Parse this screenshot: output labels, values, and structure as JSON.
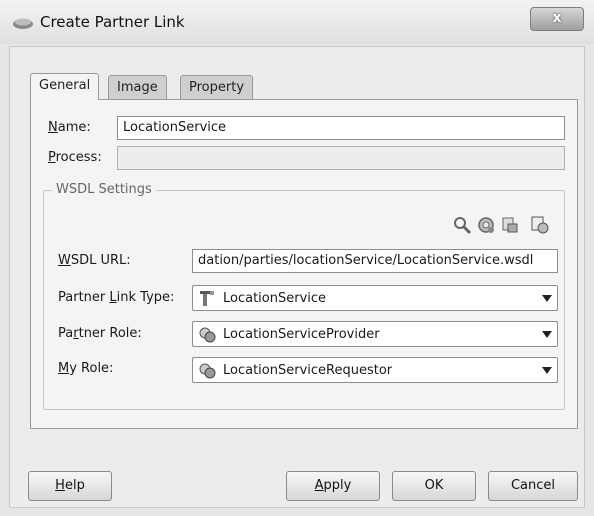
{
  "window": {
    "title": "Create Partner Link",
    "close_label": "x",
    "icon": "partner-link-icon"
  },
  "tabs": [
    {
      "label": "General",
      "active": true
    },
    {
      "label": "Image",
      "active": false
    },
    {
      "label": "Property",
      "active": false
    }
  ],
  "general": {
    "name_label": "Name:",
    "name_value": "LocationService",
    "process_label": "Process:",
    "process_value": "",
    "wsdl_group_label": "WSDL Settings",
    "toolbar_icons": [
      "search-wsdl-icon",
      "service-explorer-icon",
      "define-service-icon",
      "generate-wsdl-icon"
    ],
    "wsdl_url_label": "WSDL URL:",
    "wsdl_url_value": "dation/parties/locationService/LocationService.wsdl",
    "partner_link_type_label": "Partner Link Type:",
    "partner_link_type_value": "LocationService",
    "partner_role_label": "Partner Role:",
    "partner_role_value": "LocationServiceProvider",
    "my_role_label": "My Role:",
    "my_role_value": "LocationServiceRequestor"
  },
  "buttons": {
    "help": "Help",
    "apply": "Apply",
    "ok": "OK",
    "cancel": "Cancel"
  }
}
